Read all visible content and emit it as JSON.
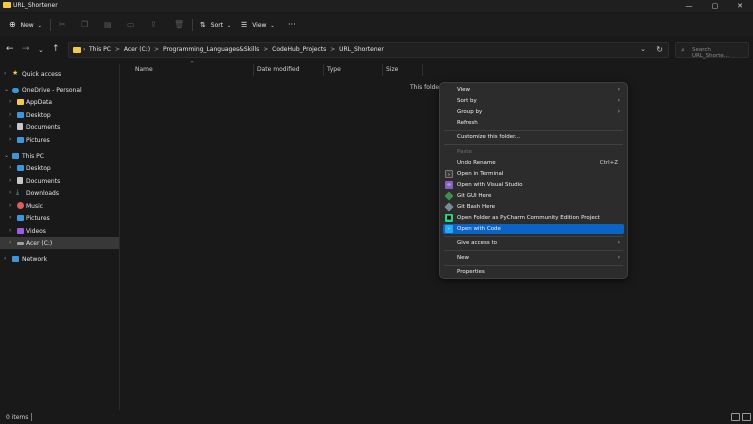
{
  "window": {
    "title": "URL_Shortener",
    "min": "—",
    "max": "▢",
    "close": "✕"
  },
  "toolbar": {
    "new_label": "New",
    "new_icon": "plus-circle-icon",
    "sort_label": "Sort",
    "view_label": "View",
    "more_label": "···"
  },
  "nav": {
    "breadcrumbs": [
      "This PC",
      "Acer (C:)",
      "Programming_Languages&Skills",
      "CodeHub_Projects",
      "URL_Shortener"
    ],
    "separator": ">",
    "search_placeholder": "Search URL_Shorte..."
  },
  "sidebar": {
    "items": [
      {
        "label": "Quick access",
        "icon": "star-icon",
        "color": "#f6c844"
      },
      {
        "label": "OneDrive - Personal",
        "icon": "cloud-icon",
        "color": "#3a96dd"
      },
      {
        "label": "AppData",
        "icon": "folder-icon",
        "color": "#f6c844"
      },
      {
        "label": "Desktop",
        "icon": "desktop-icon",
        "color": "#3a96dd"
      },
      {
        "label": "Documents",
        "icon": "documents-icon",
        "color": "#c8c8c8"
      },
      {
        "label": "Pictures",
        "icon": "pictures-icon",
        "color": "#3a96dd"
      },
      {
        "label": "This PC",
        "icon": "pc-icon",
        "color": "#3a96dd"
      },
      {
        "label": "Desktop",
        "icon": "desktop-icon",
        "color": "#3a96dd"
      },
      {
        "label": "Documents",
        "icon": "documents-icon",
        "color": "#c8c8c8"
      },
      {
        "label": "Downloads",
        "icon": "download-icon",
        "color": "#4cc2a0"
      },
      {
        "label": "Music",
        "icon": "music-icon",
        "color": "#e05b5b"
      },
      {
        "label": "Pictures",
        "icon": "pictures-icon",
        "color": "#3a96dd"
      },
      {
        "label": "Videos",
        "icon": "videos-icon",
        "color": "#9b5de5"
      },
      {
        "label": "Acer (C:)",
        "icon": "drive-icon",
        "color": "#a0a0a0"
      },
      {
        "label": "Network",
        "icon": "network-icon",
        "color": "#3a96dd"
      }
    ]
  },
  "columns": {
    "name": "Name",
    "date": "Date modified",
    "type": "Type",
    "size": "Size"
  },
  "main": {
    "empty_message": "This folder"
  },
  "status": {
    "count": "0 items"
  },
  "context_menu": {
    "items": [
      {
        "label": "View",
        "submenu": true
      },
      {
        "label": "Sort by",
        "submenu": true
      },
      {
        "label": "Group by",
        "submenu": true
      },
      {
        "label": "Refresh"
      },
      {
        "label": "Customize this folder..."
      },
      {
        "label": "Paste",
        "disabled": true
      },
      {
        "label": "Undo Rename",
        "shortcut": "Ctrl+Z"
      },
      {
        "label": "Open in Terminal",
        "icon": "terminal-icon"
      },
      {
        "label": "Open with Visual Studio",
        "icon": "visual-studio-icon"
      },
      {
        "label": "Git GUI Here",
        "icon": "git-gui-icon"
      },
      {
        "label": "Git Bash Here",
        "icon": "git-bash-icon"
      },
      {
        "label": "Open Folder as PyCharm Community Edition Project",
        "icon": "pycharm-icon"
      },
      {
        "label": "Open with Code",
        "icon": "vscode-icon",
        "highlighted": true
      },
      {
        "label": "Give access to",
        "submenu": true
      },
      {
        "label": "New",
        "submenu": true
      },
      {
        "label": "Properties"
      }
    ],
    "highlight_color": "#0a64c8"
  }
}
